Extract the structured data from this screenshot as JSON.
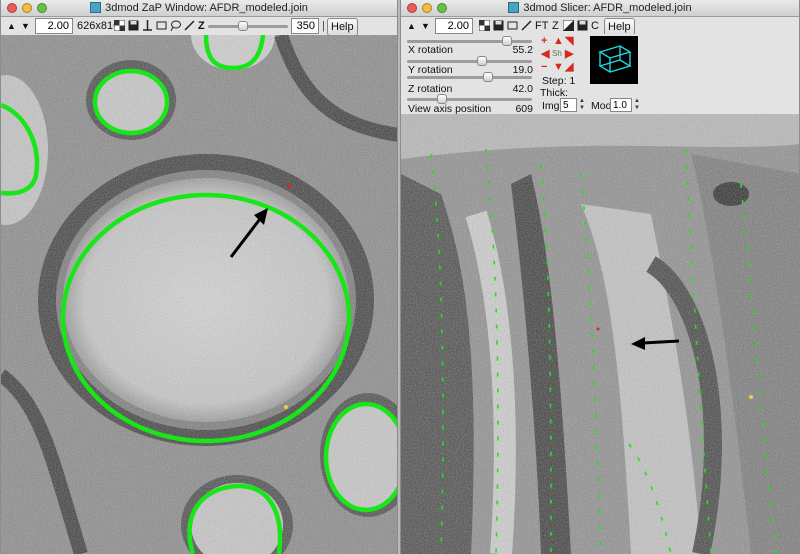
{
  "zap": {
    "title": "3dmod ZaP Window: AFDR_modeled.join",
    "zoom_value": "2.00",
    "size_label": "626x816",
    "z_label": "Z",
    "z_value": "350",
    "help_label": "Help"
  },
  "slicer": {
    "title": "3dmod Slicer: AFDR_modeled.join",
    "zoom_value": "2.00",
    "help_label": "Help",
    "ft_label": "FT",
    "c_label": "C",
    "x_rotation_label": "X rotation",
    "x_rotation_value": "55.2",
    "y_rotation_label": "Y rotation",
    "y_rotation_value": "19.0",
    "z_rotation_label": "Z rotation",
    "z_rotation_value": "42.0",
    "view_axis_label": "View axis position",
    "view_axis_value": "609",
    "step_label": "Step: 1",
    "thick_label": "Thick:",
    "img_label": "Img",
    "img_value": "5",
    "mod_label": "Mod",
    "mod_value": "1.0",
    "center_btn_label": "Sh"
  },
  "colors": {
    "contour_green": "#19e619",
    "arrow_red": "#d52a1e",
    "cube_cyan": "#1fd7df"
  },
  "icons": [
    "up-arrow-icon",
    "down-arrow-icon",
    "checker-icon",
    "save-icon",
    "pin-icon",
    "rectangle-icon",
    "lasso-icon",
    "pen-icon",
    "wireframe-cube-icon"
  ]
}
